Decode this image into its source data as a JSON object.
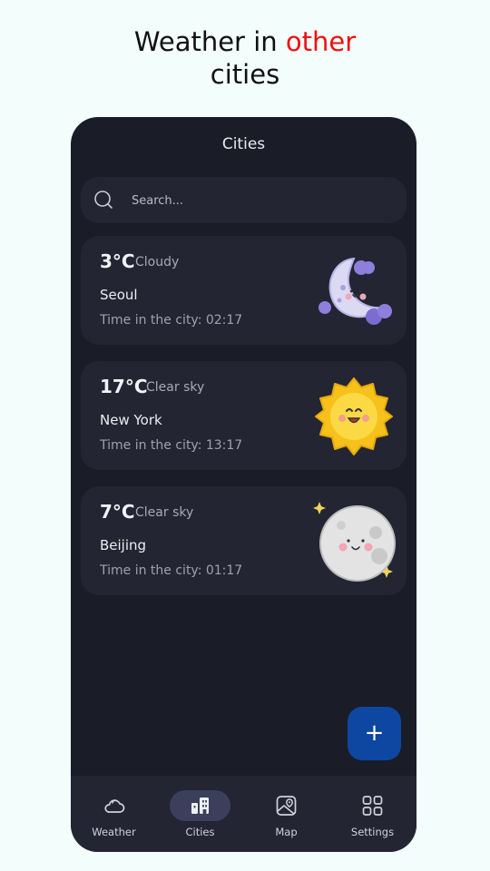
{
  "headline": {
    "part1": "Weather in ",
    "accent": "other",
    "part2": "cities"
  },
  "screen": {
    "title": "Cities"
  },
  "search": {
    "placeholder": "Search..."
  },
  "cities": [
    {
      "temp": "3°C",
      "condition": "Cloudy",
      "name": "Seoul",
      "time": "Time in the city: 02:17",
      "icon": "moon-cloud-icon"
    },
    {
      "temp": "17°C",
      "condition": "Clear sky",
      "name": "New York",
      "time": "Time in the city: 13:17",
      "icon": "sun-icon"
    },
    {
      "temp": "7°C",
      "condition": "Clear sky",
      "name": "Beijing",
      "time": "Time in the city: 01:17",
      "icon": "full-moon-icon"
    }
  ],
  "fab": {
    "label": "+"
  },
  "nav": [
    {
      "label": "Weather",
      "icon": "cloud-icon"
    },
    {
      "label": "Cities",
      "icon": "city-icon"
    },
    {
      "label": "Map",
      "icon": "map-icon"
    },
    {
      "label": "Settings",
      "icon": "grid-icon"
    }
  ],
  "colors": {
    "accent": "#ee1111",
    "fab": "#0d47a1",
    "background": "#1a1c27",
    "card": "#232533"
  }
}
